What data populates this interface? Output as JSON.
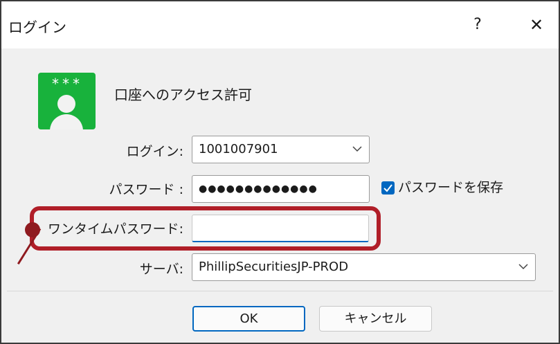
{
  "window": {
    "title": "ログイン",
    "help_label": "?",
    "close_label": "✕"
  },
  "header": {
    "icon_text": "***",
    "heading": "口座へのアクセス許可"
  },
  "form": {
    "login_label": "ログイン:",
    "login_value": "1001007901",
    "password_label": "パスワード :",
    "password_value": "●●●●●●●●●●●●●",
    "save_password_label": "パスワードを保存",
    "save_password_checked": true,
    "otp_label": "ワンタイムパスワード:",
    "otp_value": "",
    "server_label": "サーバ:",
    "server_value": "PhillipSecuritiesJP-PROD"
  },
  "buttons": {
    "ok": "OK",
    "cancel": "キャンセル"
  },
  "colors": {
    "accent": "#0067c0",
    "highlight": "#b01e28",
    "icon_green": "#18b23c"
  }
}
